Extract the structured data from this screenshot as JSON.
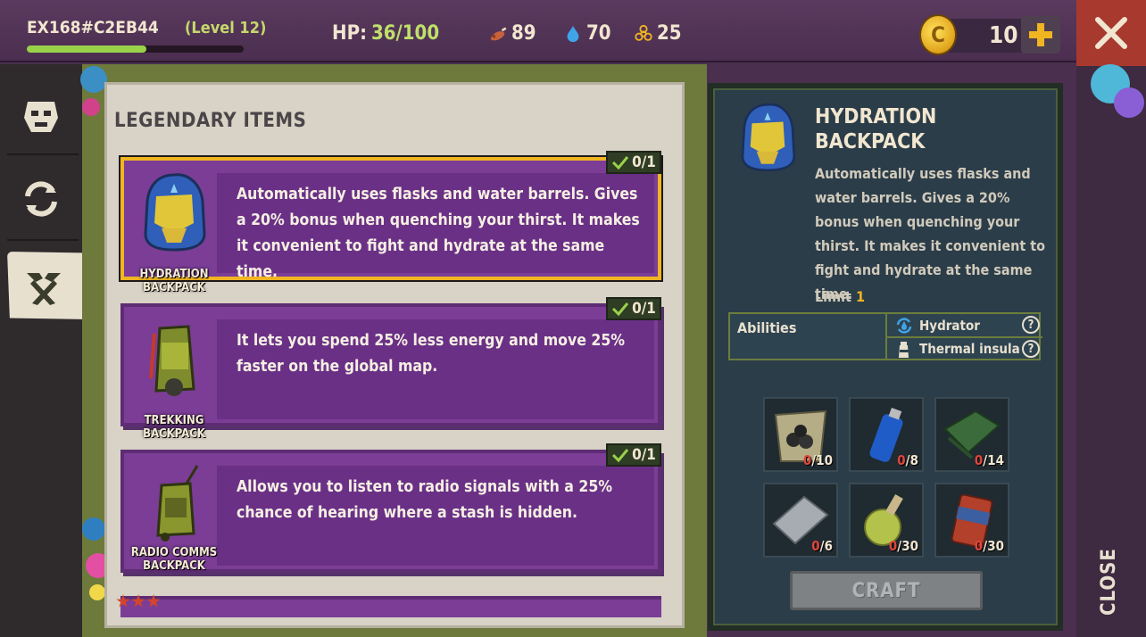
{
  "player": {
    "id": "EX168#C2EB44",
    "level": "(Level 12)",
    "xp_fraction": 0.55
  },
  "hud": {
    "hp_label": "HP:",
    "hp_value": "36/100",
    "food": "89",
    "water": "70",
    "radiation": "25",
    "coins": "10"
  },
  "icons": {
    "food": "meat-icon",
    "water": "water-drop-icon",
    "radiation": "biohazard-icon",
    "coin": "coin-icon",
    "add": "plus-icon",
    "close": "close-icon"
  },
  "rail": [
    "character-tab",
    "refresh-tab",
    "crafting-tab"
  ],
  "list": {
    "title": "LEGENDARY ITEMS",
    "items": [
      {
        "name": "HYDRATION BACKPACK",
        "desc": "Automatically uses flasks and water barrels. Gives a 20% bonus when quenching your thirst. It makes it convenient to fight and hydrate at the same time.",
        "limit": "0/1",
        "selected": true
      },
      {
        "name": "TREKKING BACKPACK",
        "desc": "It lets you spend 25% less energy and move 25% faster on the global map.",
        "limit": "0/1",
        "selected": false
      },
      {
        "name": "RADIO COMMS BACKPACK",
        "desc": "Allows you to listen to radio signals with a 25% chance of hearing where a stash is hidden.",
        "limit": "0/1",
        "selected": false
      }
    ]
  },
  "detail": {
    "title": "HYDRATION BACKPACK",
    "desc": "Automatically uses flasks and water barrels. Gives a 20% bonus when quenching your thirst. It makes it convenient to fight and hydrate at the same time.",
    "limit_label": "Limit",
    "limit_value": "1",
    "abilities_label": "Abilities",
    "abilities": [
      {
        "name": "Hydrator",
        "icon": "hydrator-icon"
      },
      {
        "name": "Thermal insulatio",
        "icon": "thermal-flask-icon"
      }
    ],
    "resources": [
      {
        "icon": "coal-bag-icon",
        "have": "0",
        "need": "/10"
      },
      {
        "icon": "spray-can-icon",
        "have": "0",
        "need": "/8"
      },
      {
        "icon": "tarp-icon",
        "have": "0",
        "need": "/14"
      },
      {
        "icon": "metal-sheet-icon",
        "have": "0",
        "need": "/6"
      },
      {
        "icon": "chemical-flask-icon",
        "have": "0",
        "need": "/30"
      },
      {
        "icon": "canned-food-icon",
        "have": "0",
        "need": "/30"
      }
    ],
    "craft_label": "CRAFT"
  },
  "close_label": "CLOSE",
  "colors": {
    "card": "#7b3d96",
    "selected_border": "#f0b521",
    "detail_bg": "#2b3d49",
    "frame_green": "#6d7a3b"
  }
}
